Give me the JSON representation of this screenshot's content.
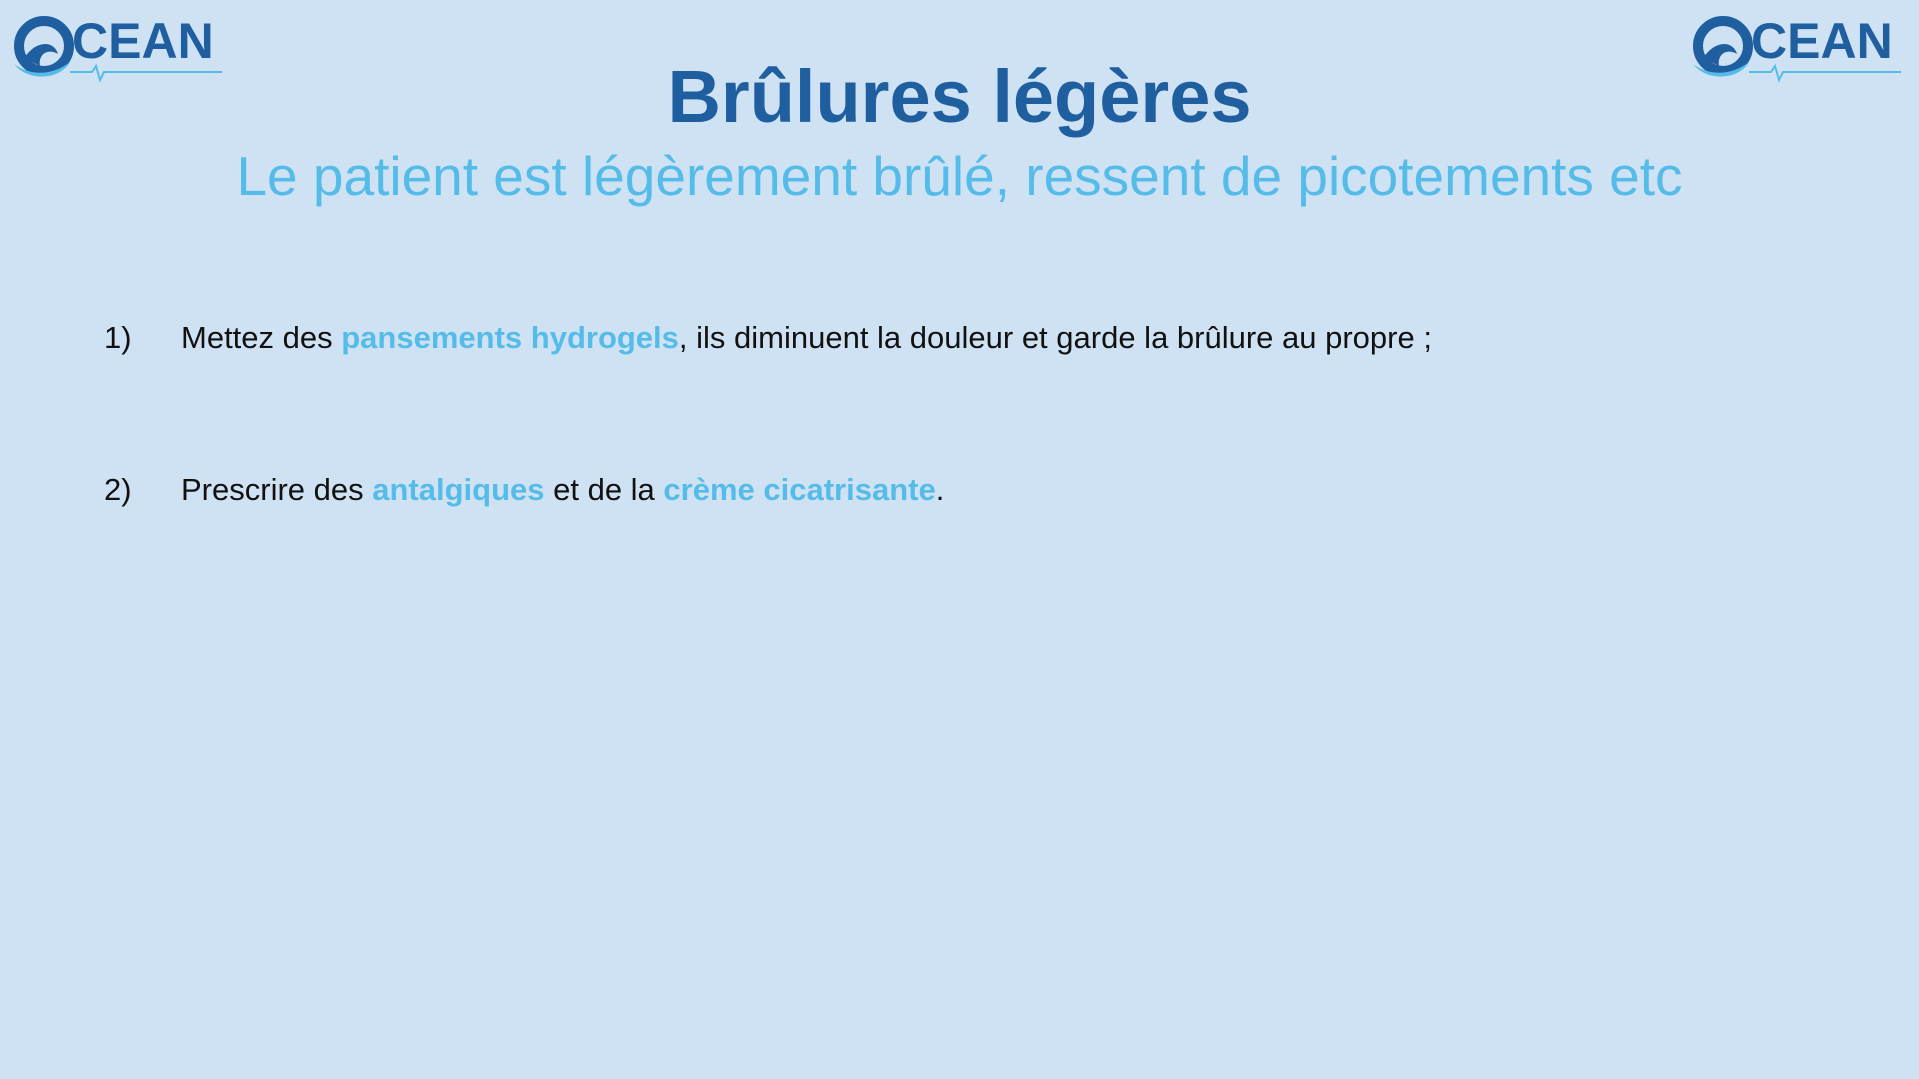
{
  "logo": {
    "left_text": "CEAN",
    "right_text": "CEAN",
    "primary_color": "#1f5fa0",
    "accent_color": "#55bce9"
  },
  "header": {
    "title": "Brûlures légères",
    "subtitle": "Le patient est légèrement brûlé, ressent de picotements etc"
  },
  "steps": [
    {
      "number": "1)",
      "before": "Mettez des ",
      "highlight": "pansements hydrogels",
      "after": ", ils diminuent la douleur et garde la brûlure au propre ;"
    },
    {
      "number": "2)",
      "before": "Prescrire des ",
      "highlight": "antalgiques",
      "middle": " et de la ",
      "highlight2": "crème cicatrisante",
      "after": "."
    }
  ],
  "colors": {
    "background": "#cfe2f3",
    "title": "#1f5fa0",
    "highlight": "#55bce9",
    "body_text": "#111111"
  }
}
